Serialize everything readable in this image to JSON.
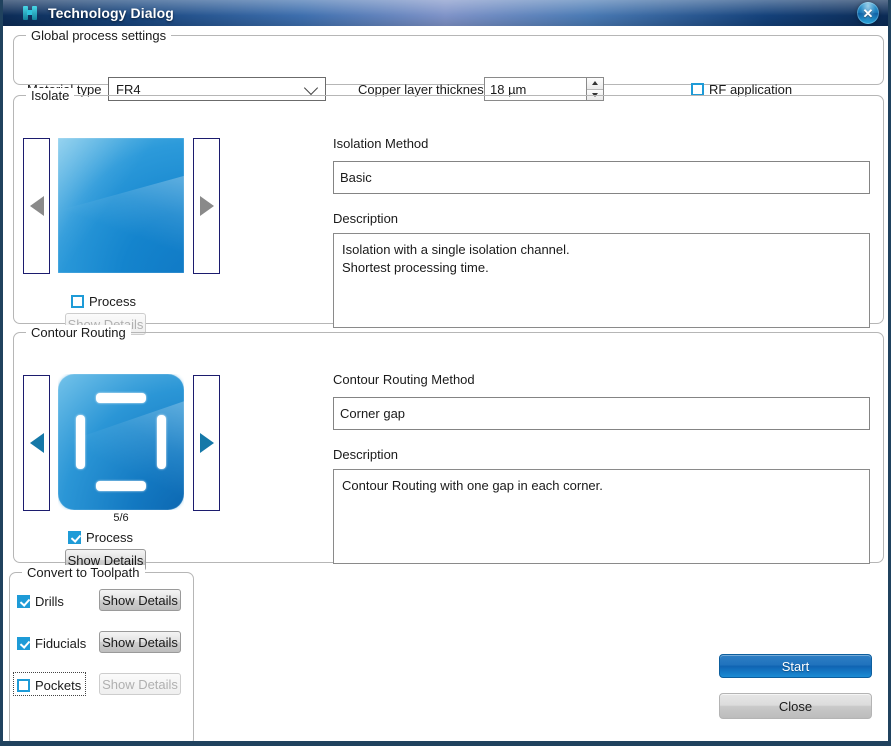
{
  "titlebar": {
    "title": "Technology Dialog",
    "app_icon": "circuit-board-icon",
    "close_label": "✕"
  },
  "global_settings": {
    "legend": "Global process settings",
    "material_type_label": "Material type",
    "material_type_value": "FR4",
    "material_type_placeholder": "FR4",
    "copper_thickness_label": "Copper layer thickness",
    "copper_thickness_value": "18 µm",
    "rf_application_label": "RF application",
    "rf_application_checked": false
  },
  "isolate": {
    "legend": "Isolate",
    "prev_arrow": "◀",
    "next_arrow": "▶",
    "prev_enabled": false,
    "next_enabled": false,
    "counter": "",
    "process_label": "Process",
    "process_checked": false,
    "show_details_label": "Show Details",
    "show_details_enabled": false,
    "method_label": "Isolation Method",
    "method_value": "Basic",
    "description_label": "Description",
    "description_value": "Isolation with a single isolation channel.\nShortest processing time.",
    "preview_name": "isolation-basic-preview"
  },
  "contour_routing": {
    "legend": "Contour Routing",
    "prev_arrow": "◀",
    "next_arrow": "▶",
    "prev_enabled": true,
    "next_enabled": true,
    "counter": "5/6",
    "process_label": "Process",
    "process_checked": true,
    "show_details_label": "Show Details",
    "show_details_enabled": true,
    "method_label": "Contour Routing Method",
    "method_value": "Corner gap",
    "description_label": "Description",
    "description_value": "Contour Routing with one gap in each corner.",
    "preview_name": "contour-corner-gap-preview"
  },
  "convert_to_toolpath": {
    "legend": "Convert to Toolpath",
    "rows": [
      {
        "label": "Drills",
        "checked": true,
        "button_label": "Show Details",
        "button_enabled": true,
        "focused": false
      },
      {
        "label": "Fiducials",
        "checked": true,
        "button_label": "Show Details",
        "button_enabled": true,
        "focused": false
      },
      {
        "label": "Pockets",
        "checked": false,
        "button_label": "Show Details",
        "button_enabled": false,
        "focused": true
      }
    ]
  },
  "actions": {
    "start_label": "Start",
    "close_label": "Close"
  },
  "colors": {
    "accent_blue": "#1e9bd7",
    "titlebar_dark": "#0c2b55",
    "titlebar_light": "#7f93c8",
    "start_button": "#1f72bd",
    "window_border": "#20425e",
    "arrow_enabled": "#1578a8",
    "arrow_disabled": "#8a8a8a"
  }
}
